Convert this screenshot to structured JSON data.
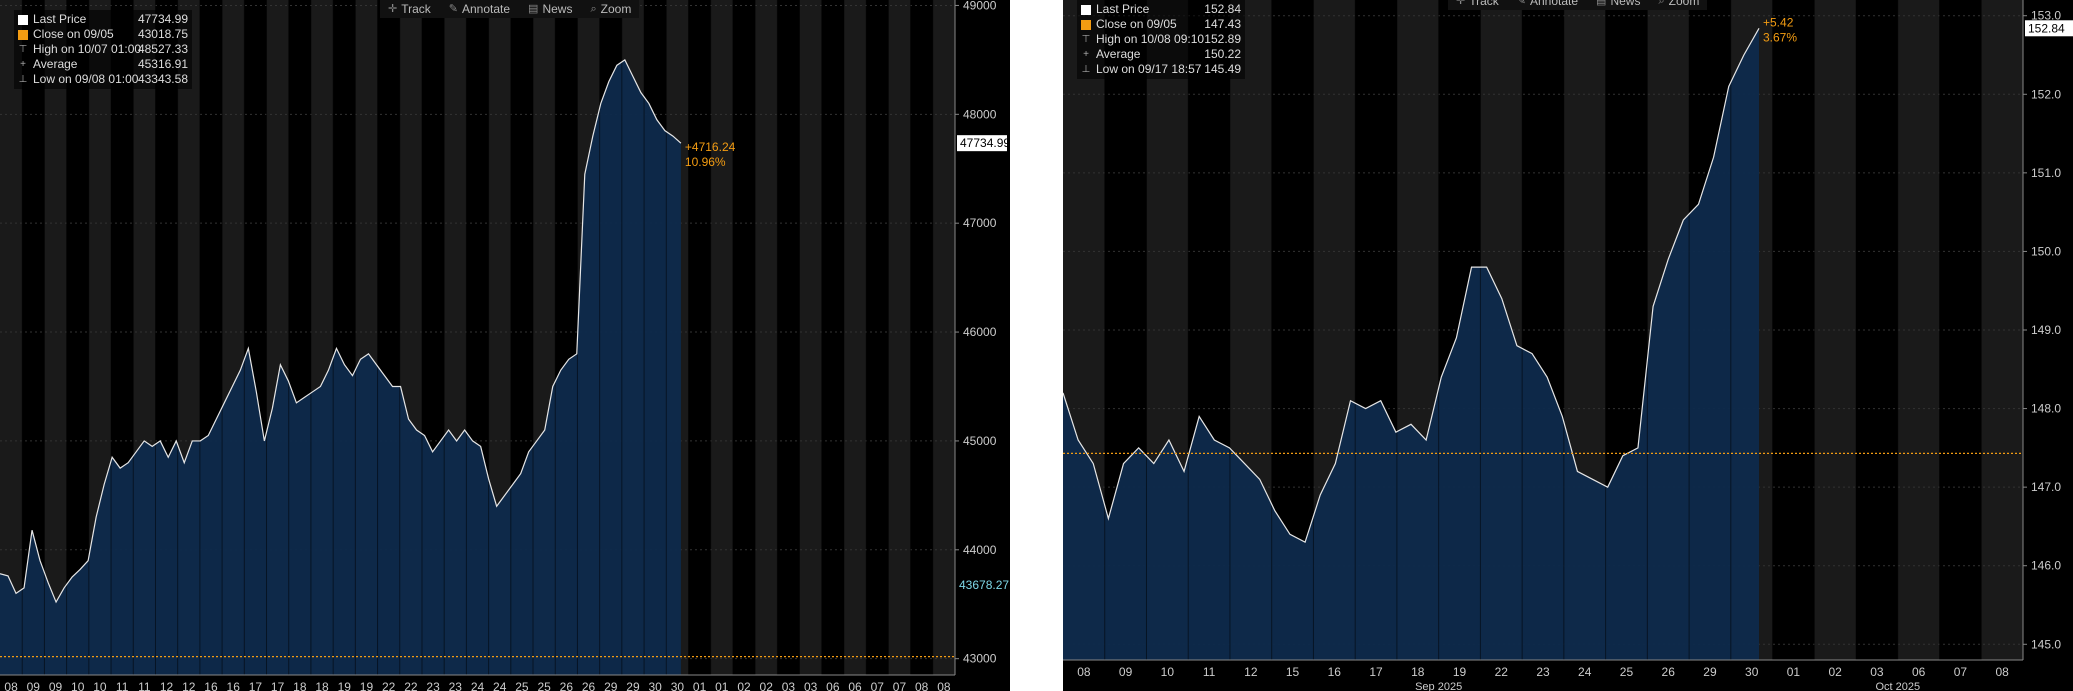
{
  "toolbar": {
    "items": [
      {
        "label": "Track",
        "icon": "crosshair-icon"
      },
      {
        "label": "Annotate",
        "icon": "pencil-icon"
      },
      {
        "label": "News",
        "icon": "news-icon"
      },
      {
        "label": "Zoom",
        "icon": "magnifier-icon"
      }
    ]
  },
  "colors": {
    "background": "#000000",
    "area_fill": "#0e2a4c",
    "price_line": "#e6e6e6",
    "reference_line": "#f39c12",
    "shade_band": "#1a1a1a",
    "change_text": "#f39c12"
  },
  "chart_data": [
    {
      "type": "area",
      "legend": {
        "rows": [
          {
            "label": "Last Price",
            "value": "47734.99",
            "swatch": "#ffffff"
          },
          {
            "label": "Close on 09/05",
            "value": "43018.75",
            "swatch": "#f39c12"
          },
          {
            "label": "High on 10/07 01:00",
            "value": "48527.33",
            "swatch": "high-marker-icon"
          },
          {
            "label": "Average",
            "value": "45316.91",
            "swatch": "average-marker-icon"
          },
          {
            "label": "Low on 09/08 01:00",
            "value": "43343.58",
            "swatch": "low-marker-icon"
          }
        ]
      },
      "x_tick_labels": [
        "08",
        "09",
        "09",
        "10",
        "10",
        "11",
        "11",
        "12",
        "12",
        "16",
        "16",
        "17",
        "17",
        "18",
        "18",
        "19",
        "19",
        "22",
        "22",
        "23",
        "23",
        "24",
        "24",
        "25",
        "25",
        "26",
        "26",
        "29",
        "29",
        "30",
        "30",
        "01",
        "01",
        "02",
        "02",
        "03",
        "03",
        "06",
        "06",
        "07",
        "07",
        "08",
        "08"
      ],
      "y_ticks": [
        43000,
        44000,
        45000,
        46000,
        47000,
        48000,
        49000
      ],
      "ylim": [
        42850,
        49050
      ],
      "reference_value": 43018.75,
      "last_price_label": "47734.99",
      "low_label": "43678.27",
      "change_abs": "+4716.24",
      "change_pct": "10.96%",
      "grid": true,
      "values": [
        43780,
        43760,
        43600,
        43650,
        44180,
        43900,
        43700,
        43520,
        43650,
        43750,
        43820,
        43900,
        44300,
        44600,
        44850,
        44750,
        44800,
        44900,
        45000,
        44950,
        45000,
        44850,
        45000,
        44800,
        45000,
        45000,
        45050,
        45200,
        45350,
        45500,
        45650,
        45850,
        45450,
        45000,
        45300,
        45700,
        45550,
        45350,
        45400,
        45450,
        45500,
        45650,
        45850,
        45700,
        45600,
        45750,
        45800,
        45700,
        45600,
        45500,
        45500,
        45200,
        45100,
        45050,
        44900,
        45000,
        45100,
        45000,
        45100,
        45000,
        44950,
        44650,
        44400,
        44500,
        44600,
        44700,
        44900,
        45000,
        45100,
        45500,
        45650,
        45750,
        45800,
        47450,
        47800,
        48100,
        48300,
        48450,
        48500,
        48350,
        48200,
        48100,
        47950,
        47850,
        47800,
        47734.99
      ],
      "x_labels_style": "daily"
    },
    {
      "type": "area",
      "legend": {
        "rows": [
          {
            "label": "Last Price",
            "value": "152.84",
            "swatch": "#ffffff"
          },
          {
            "label": "Close on 09/05",
            "value": "147.43",
            "swatch": "#f39c12"
          },
          {
            "label": "High on 10/08 09:10",
            "value": "152.89",
            "swatch": "high-marker-icon"
          },
          {
            "label": "Average",
            "value": "150.22",
            "swatch": "average-marker-icon"
          },
          {
            "label": "Low on 09/17 18:57",
            "value": "145.49",
            "swatch": "low-marker-icon"
          }
        ]
      },
      "x_tick_labels": [
        "08",
        "09",
        "10",
        "11",
        "12",
        "15",
        "16",
        "17",
        "18",
        "19",
        "22",
        "23",
        "24",
        "25",
        "26",
        "29",
        "30",
        "01",
        "02",
        "03",
        "06",
        "07",
        "08"
      ],
      "month_labels": [
        {
          "label": "Sep 2025",
          "index": 8.5
        },
        {
          "label": "Oct 2025",
          "index": 19.5
        }
      ],
      "y_ticks": [
        145,
        146,
        147,
        148,
        149,
        150,
        151,
        152,
        153
      ],
      "ylim": [
        144.8,
        153.2
      ],
      "reference_value": 147.43,
      "last_price_label": "152.84",
      "change_abs": "+5.42",
      "change_pct": "3.67%",
      "grid": true,
      "values": [
        148.2,
        147.6,
        147.3,
        146.6,
        147.3,
        147.5,
        147.3,
        147.6,
        147.2,
        147.9,
        147.6,
        147.5,
        147.3,
        147.1,
        146.7,
        146.4,
        146.3,
        146.9,
        147.3,
        148.1,
        148.0,
        148.1,
        147.7,
        147.8,
        147.6,
        148.4,
        148.9,
        149.8,
        149.8,
        149.4,
        148.8,
        148.7,
        148.4,
        147.9,
        147.2,
        147.1,
        147.0,
        147.4,
        147.5,
        149.3,
        149.9,
        150.4,
        150.6,
        151.2,
        152.1,
        152.5,
        152.84
      ]
    }
  ]
}
